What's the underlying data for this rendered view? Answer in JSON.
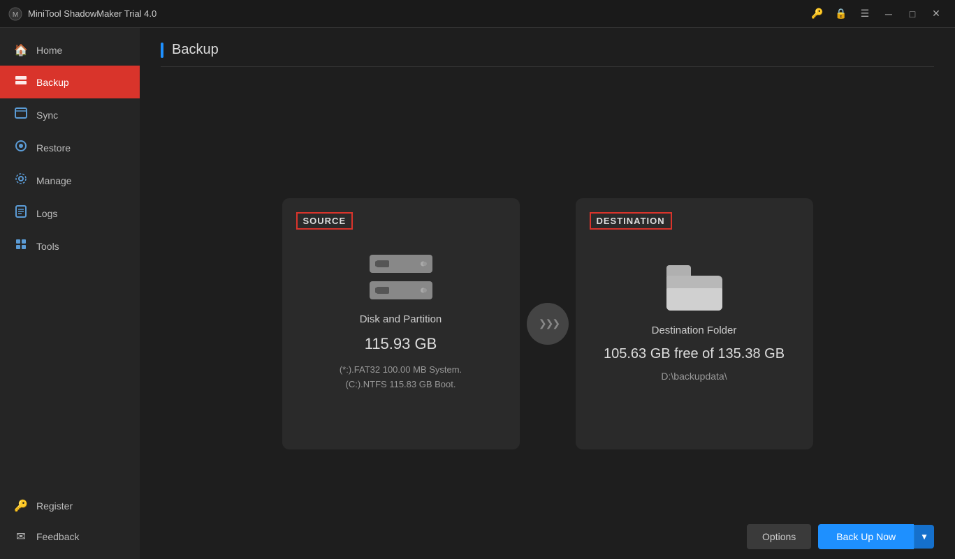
{
  "titleBar": {
    "appName": "MiniTool ShadowMaker Trial 4.0",
    "icons": {
      "key": "🔑",
      "shield": "🔒",
      "menu": "☰",
      "minimize": "─",
      "maximize": "□",
      "close": "✕"
    }
  },
  "sidebar": {
    "items": [
      {
        "id": "home",
        "label": "Home",
        "icon": "🏠",
        "active": false
      },
      {
        "id": "backup",
        "label": "Backup",
        "icon": "🖼",
        "active": true
      },
      {
        "id": "sync",
        "label": "Sync",
        "icon": "📋",
        "active": false
      },
      {
        "id": "restore",
        "label": "Restore",
        "icon": "⚙",
        "active": false
      },
      {
        "id": "manage",
        "label": "Manage",
        "icon": "⚙",
        "active": false
      },
      {
        "id": "logs",
        "label": "Logs",
        "icon": "📄",
        "active": false
      },
      {
        "id": "tools",
        "label": "Tools",
        "icon": "🔧",
        "active": false
      }
    ],
    "bottomItems": [
      {
        "id": "register",
        "label": "Register",
        "icon": "🔑"
      },
      {
        "id": "feedback",
        "label": "Feedback",
        "icon": "✉"
      }
    ]
  },
  "content": {
    "pageTitle": "Backup",
    "source": {
      "label": "SOURCE",
      "type": "Disk and Partition",
      "size": "115.93 GB",
      "detail1": "(*:).FAT32 100.00 MB System.",
      "detail2": "(C:).NTFS 115.83 GB Boot."
    },
    "destination": {
      "label": "DESTINATION",
      "type": "Destination Folder",
      "free": "105.63 GB free of 135.38 GB",
      "path": "D:\\backupdata\\"
    },
    "arrowSymbol": ">>>",
    "buttons": {
      "options": "Options",
      "backupNow": "Back Up Now",
      "dropdownArrow": "▼"
    }
  }
}
